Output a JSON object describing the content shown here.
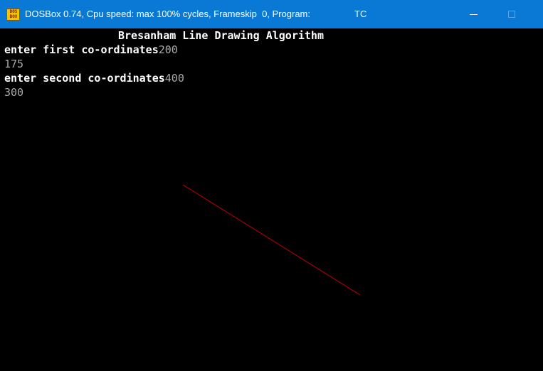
{
  "window": {
    "title": "DOSBox 0.74, Cpu speed: max 100% cycles, Frameskip  0, Program:",
    "program": "TC",
    "icon": "dosbox-icon",
    "icon_text_top": "DOS",
    "icon_text_bottom": "BOX",
    "titlebar_color": "#0a79d6"
  },
  "screen": {
    "heading": "Bresanham Line Drawing Algorithm",
    "prompts": [
      {
        "label": "enter first co-ordinates",
        "value": "200"
      },
      {
        "label": "",
        "value": "175"
      },
      {
        "label": "enter second co-ordinates",
        "value": "400"
      },
      {
        "label": "",
        "value": "300"
      }
    ],
    "line_color": "#aa0000"
  }
}
